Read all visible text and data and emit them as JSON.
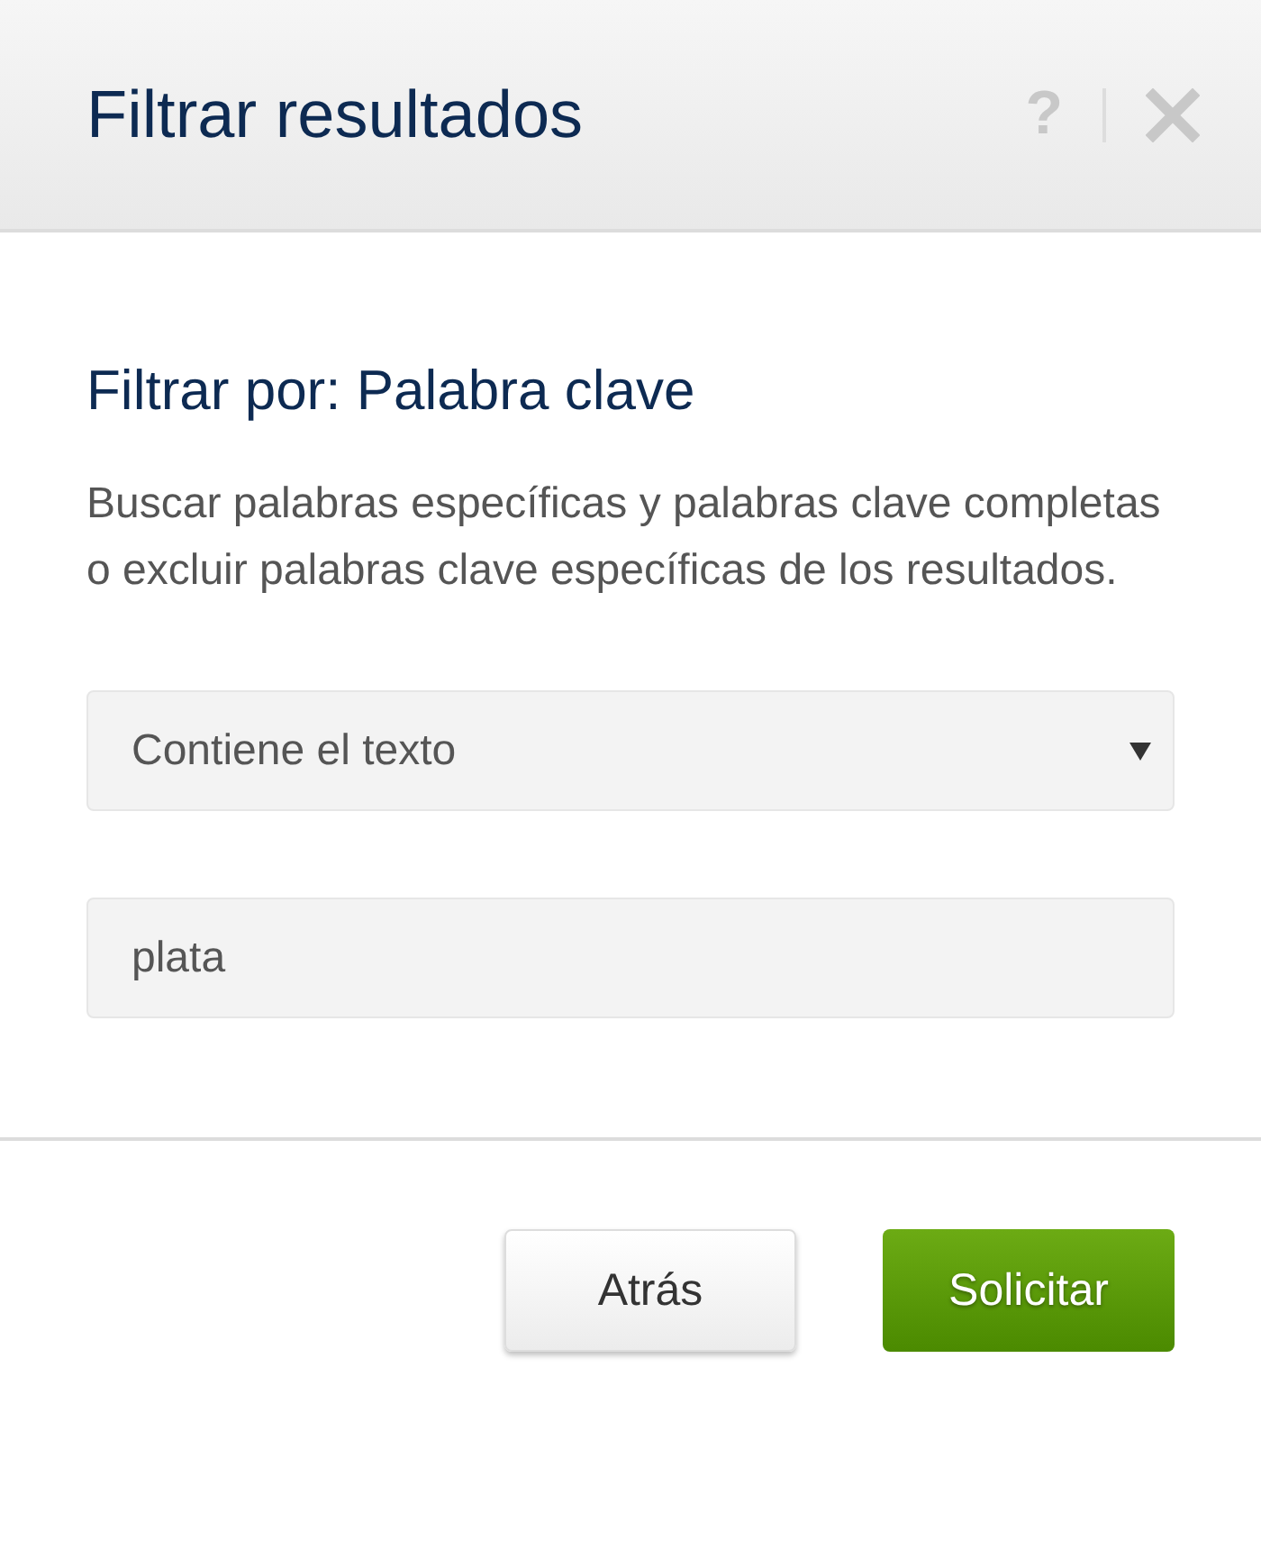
{
  "dialog": {
    "title": "Filtrar resultados",
    "help_label": "?",
    "section_title": "Filtrar por: Palabra clave",
    "description": "Buscar palabras específicas y palabras clave completas o excluir palabras clave específicas de los resultados.",
    "match_select": {
      "value": "Contiene el texto"
    },
    "keyword_field": {
      "value": "plata"
    },
    "buttons": [
      {
        "label": "Atrás",
        "kind": "secondary"
      },
      {
        "label": "Solicitar",
        "kind": "primary"
      }
    ]
  }
}
